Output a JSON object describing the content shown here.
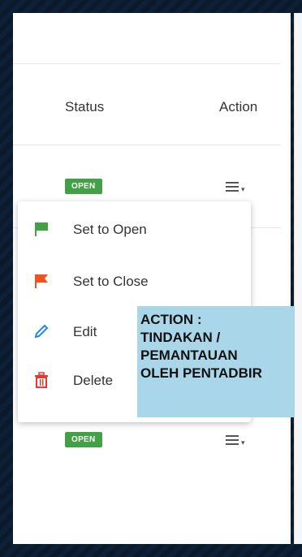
{
  "table": {
    "headers": {
      "status": "Status",
      "action": "Action"
    },
    "rows": [
      {
        "status": "OPEN"
      },
      {
        "status": "OPEN"
      }
    ]
  },
  "dropdown": {
    "items": [
      {
        "label": "Set to Open",
        "icon": "green-flag-icon",
        "color": "#43a047"
      },
      {
        "label": "Set to Close",
        "icon": "red-flag-icon",
        "color": "#f4511e"
      },
      {
        "label": "Edit",
        "icon": "pencil-icon",
        "color": "#1e88e5"
      },
      {
        "label": "Delete",
        "icon": "trash-icon",
        "color": "#e53935"
      }
    ]
  },
  "annotation": {
    "lines": [
      "ACTION :",
      "TINDAKAN /",
      "PEMANTAUAN",
      "OLEH PENTADBIR"
    ]
  },
  "colors": {
    "badge": "#43a047",
    "annotation_bg": "#a9d7e9"
  }
}
